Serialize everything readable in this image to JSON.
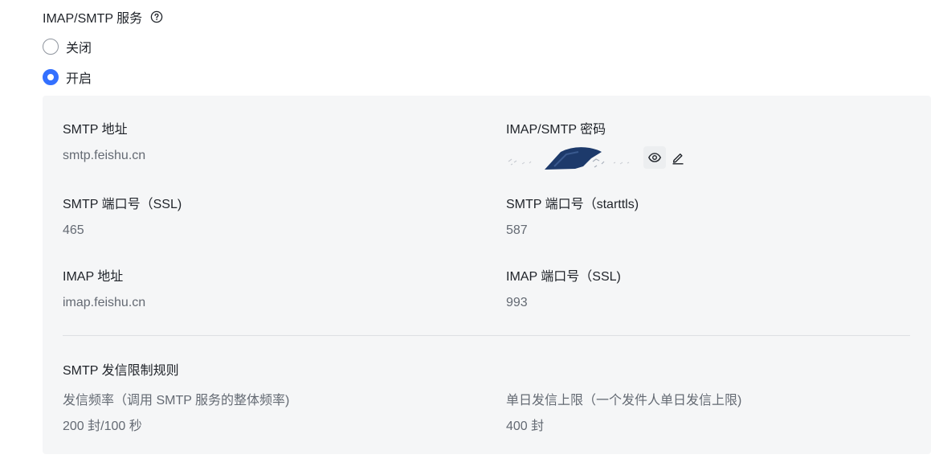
{
  "section": {
    "title": "IMAP/SMTP 服务"
  },
  "options": [
    {
      "label": "关闭",
      "checked": false
    },
    {
      "label": "开启",
      "checked": true
    }
  ],
  "colors": {
    "accent": "#3370ff",
    "panel_bg": "#f5f6f7",
    "text_primary": "#1f2329",
    "text_secondary": "#646a73"
  },
  "settings": {
    "smtp_address_label": "SMTP 地址",
    "smtp_address_value": "smtp.feishu.cn",
    "password_label": "IMAP/SMTP 密码",
    "smtp_ssl_port_label": "SMTP 端口号（SSL)",
    "smtp_ssl_port_value": "465",
    "smtp_starttls_port_label": "SMTP 端口号（starttls)",
    "smtp_starttls_port_value": "587",
    "imap_address_label": "IMAP 地址",
    "imap_address_value": "imap.feishu.cn",
    "imap_ssl_port_label": "IMAP 端口号（SSL)",
    "imap_ssl_port_value": "993"
  },
  "limits": {
    "title": "SMTP 发信限制规则",
    "rate_label": "发信频率（调用 SMTP 服务的整体频率)",
    "rate_value": "200 封/100 秒",
    "daily_label": "单日发信上限（一个发件人单日发信上限)",
    "daily_value": "400 封"
  },
  "icons": {
    "help": "question-circle-icon",
    "show_password": "eye-icon",
    "edit_password": "pencil-icon"
  }
}
